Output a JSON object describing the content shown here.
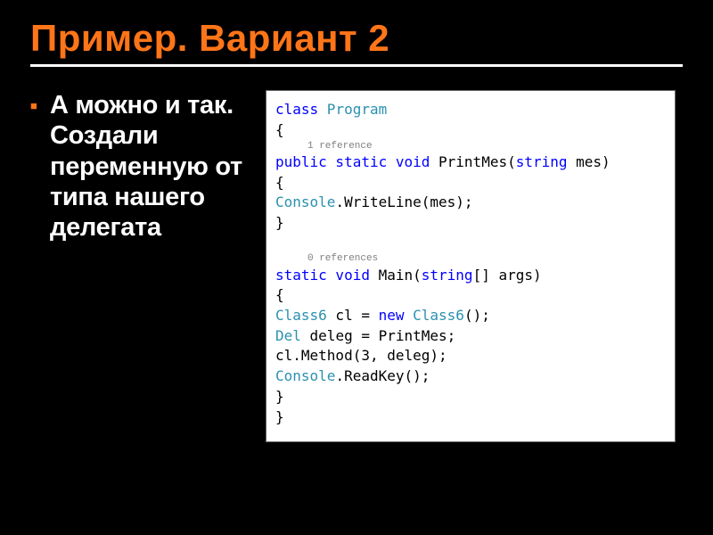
{
  "slide": {
    "title": "Пример. Вариант 2",
    "bullet": "А можно и так. Создали переменную от типа нашего делегата"
  },
  "code": {
    "line1_kw1": "class",
    "line1_type": " Program",
    "brace_open": "{",
    "ref1": "1 reference",
    "m1_kw": "public static void",
    "m1_name": " PrintMes(",
    "m1_pkw": "string",
    "m1_rest": " mes)",
    "m1_body_type": "Console",
    "m1_body_rest": ".WriteLine(mes);",
    "ref2": "0 references",
    "m2_kw": "static void",
    "m2_name": " Main(",
    "m2_pkw": "string",
    "m2_rest": "[] args)",
    "b1_type": "Class6",
    "b1_rest1": " cl = ",
    "b1_kw": "new",
    "b1_rest2": " ",
    "b1_type2": "Class6",
    "b1_rest3": "();",
    "b2_type": "Del",
    "b2_rest": " deleg = PrintMes;",
    "b3": "cl.Method(3, deleg);",
    "b4_type": "Console",
    "b4_rest": ".ReadKey();",
    "brace_close": "}"
  }
}
